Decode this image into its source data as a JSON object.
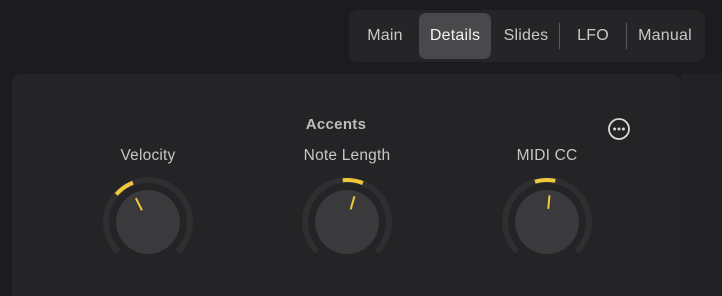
{
  "tabs": [
    {
      "label": "Main",
      "active": false
    },
    {
      "label": "Details",
      "active": true
    },
    {
      "label": "Slides",
      "active": false
    },
    {
      "label": "LFO",
      "active": false
    },
    {
      "label": "Manual",
      "active": false
    }
  ],
  "section": {
    "title": "Accents",
    "more_icon": "ellipsis-circle-icon"
  },
  "knobs": [
    {
      "label": "Velocity",
      "value_fraction": 0.4
    },
    {
      "label": "Note Length",
      "value_fraction": 0.56
    },
    {
      "label": "MIDI CC",
      "value_fraction": 0.52
    }
  ],
  "colors": {
    "accent": "#f0c93a",
    "knob_body": "#3a3a3c",
    "track": "#2f2f31",
    "pointer": "#f0c93a",
    "active_tab": "#49494c"
  }
}
